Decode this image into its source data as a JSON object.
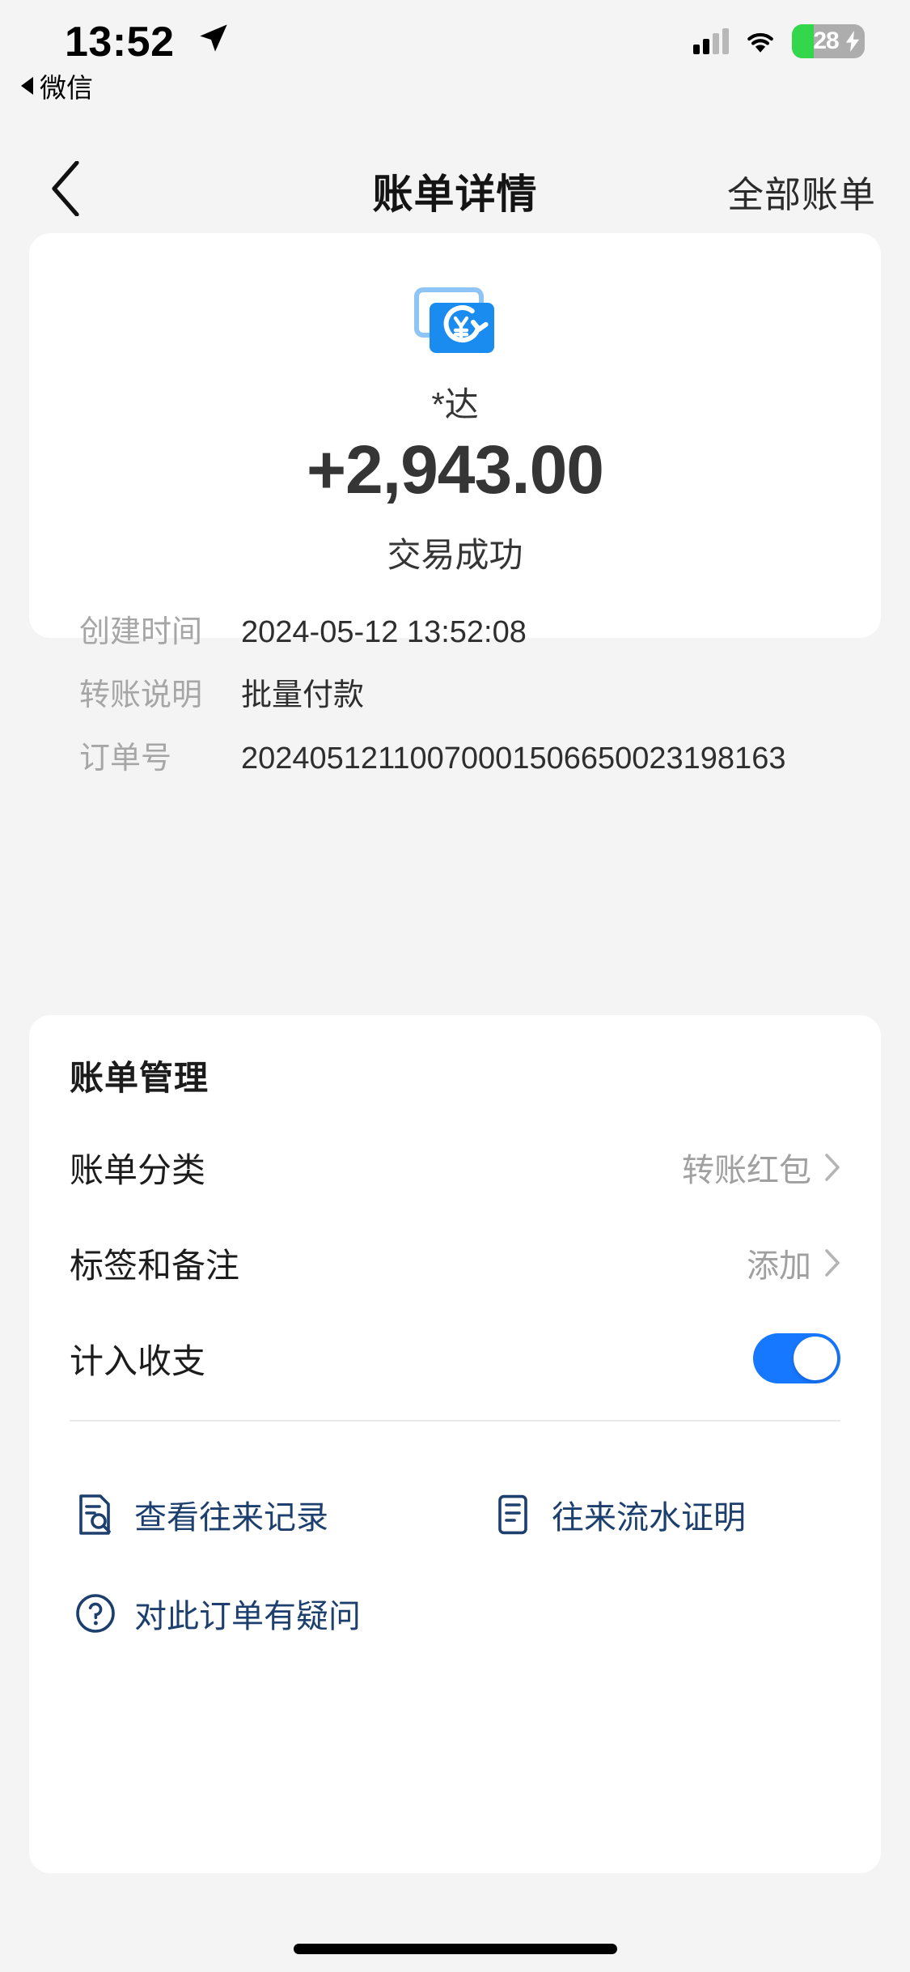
{
  "status_bar": {
    "time": "13:52",
    "location_icon": "location-arrow-icon",
    "signal_icon": "cellular-signal-icon",
    "wifi_icon": "wifi-icon",
    "battery_level": "28",
    "battery_charging": true,
    "battery_fill_color": "#32d74b"
  },
  "return_app": {
    "label": "微信",
    "icon": "back-triangle-icon"
  },
  "navbar": {
    "back_icon": "chevron-left-icon",
    "title": "账单详情",
    "right_action": "全部账单"
  },
  "detail": {
    "icon": "transfer-card-yuan-icon",
    "icon_color": "#1a8cf0",
    "payee": "*达",
    "amount": "+2,943.00",
    "status": "交易成功",
    "fields": [
      {
        "label": "创建时间",
        "value": "2024-05-12 13:52:08"
      },
      {
        "label": "转账说明",
        "value": "批量付款"
      },
      {
        "label": "订单号",
        "value": "20240512110070001506650023198163"
      }
    ]
  },
  "manage": {
    "title": "账单管理",
    "rows": [
      {
        "label": "账单分类",
        "value": "转账红包",
        "chevron": "chevron-right-icon"
      },
      {
        "label": "标签和备注",
        "value": "添加",
        "chevron": "chevron-right-icon"
      }
    ],
    "toggle_row": {
      "label": "计入收支",
      "state": "on",
      "accent_color": "#1677ff"
    },
    "links": [
      {
        "label": "查看往来记录",
        "icon": "document-search-icon"
      },
      {
        "label": "往来流水证明",
        "icon": "document-lines-icon"
      },
      {
        "label": "对此订单有疑问",
        "icon": "question-circle-icon"
      }
    ],
    "link_color": "#1d3f6e"
  },
  "home_indicator": "home-indicator"
}
